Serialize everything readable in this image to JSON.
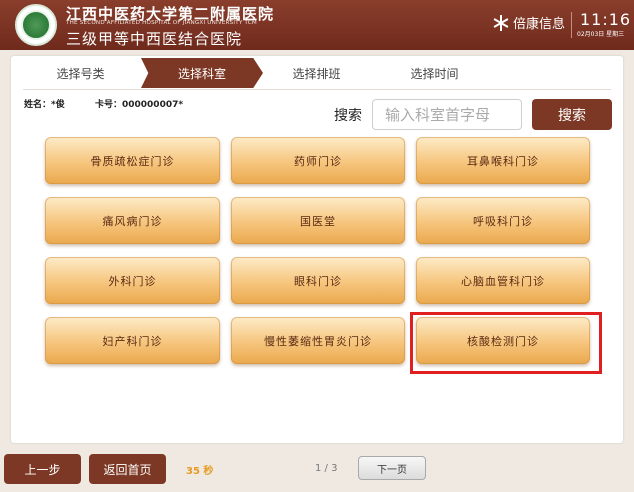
{
  "header": {
    "hospital_name": "江西中医药大学第二附属医院",
    "hospital_name_en": "THE SECOND AFFILIATED HOSPITAL OF JIANGXI UNIVERSITY TCM",
    "hospital_subtitle": "三级甲等中西医结合医院",
    "info_label": "倍康信息",
    "time": "11:16",
    "date": "02月03日 星期三"
  },
  "steps": [
    {
      "label": "选择号类",
      "active": false
    },
    {
      "label": "选择科室",
      "active": true
    },
    {
      "label": "选择排班",
      "active": false
    },
    {
      "label": "选择时间",
      "active": false
    }
  ],
  "patient": {
    "name": "姓名：*俊",
    "card": "卡号：000000007*"
  },
  "search": {
    "label": "搜索",
    "placeholder": "输入科室首字母",
    "button": "搜索"
  },
  "departments": [
    "骨质疏松症门诊",
    "药师门诊",
    "耳鼻喉科门诊",
    "痛风病门诊",
    "国医堂",
    "呼吸科门诊",
    "外科门诊",
    "眼科门诊",
    "心脑血管科门诊",
    "妇产科门诊",
    "慢性萎缩性胃炎门诊",
    "核酸检测门诊"
  ],
  "footer": {
    "back": "上一步",
    "home": "返回首页",
    "countdown": "35 秒",
    "page": "1 / 3",
    "next": "下一页"
  },
  "colors": {
    "brand": "#7d3825",
    "highlight": "#e0201e",
    "countdown": "#e59b21"
  }
}
